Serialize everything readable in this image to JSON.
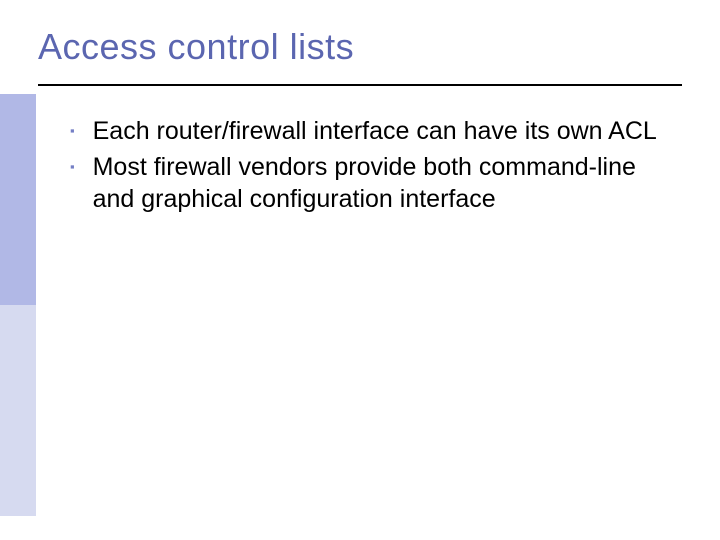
{
  "slide": {
    "title": "Access control lists",
    "bullets": [
      "Each router/firewall interface can have its own ACL",
      "Most firewall vendors provide both command-line and graphical configuration interface"
    ]
  }
}
